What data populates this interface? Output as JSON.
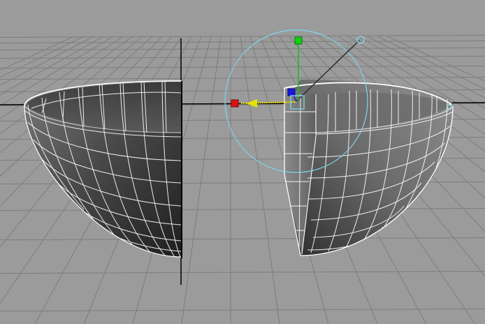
{
  "viewport": {
    "view": "perspective",
    "background_color": "#9b9b9b",
    "grid_color": "#7d7d7d",
    "axis_color": "#000000",
    "wireframe_color": "#ffffff"
  },
  "objects": [
    {
      "name": "hemisphere-shell-left",
      "type": "hemisphere",
      "selected": false
    },
    {
      "name": "hemisphere-shell-right",
      "type": "hemisphere",
      "selected": true
    }
  ],
  "manipulator": {
    "mode": "move",
    "x_handle_color": "#e01010",
    "y_handle_color": "#10d010",
    "z_handle_color": "#1818e0",
    "rotate_ring_color": "#7fd4e8",
    "arrow_color": "#e8e000"
  }
}
